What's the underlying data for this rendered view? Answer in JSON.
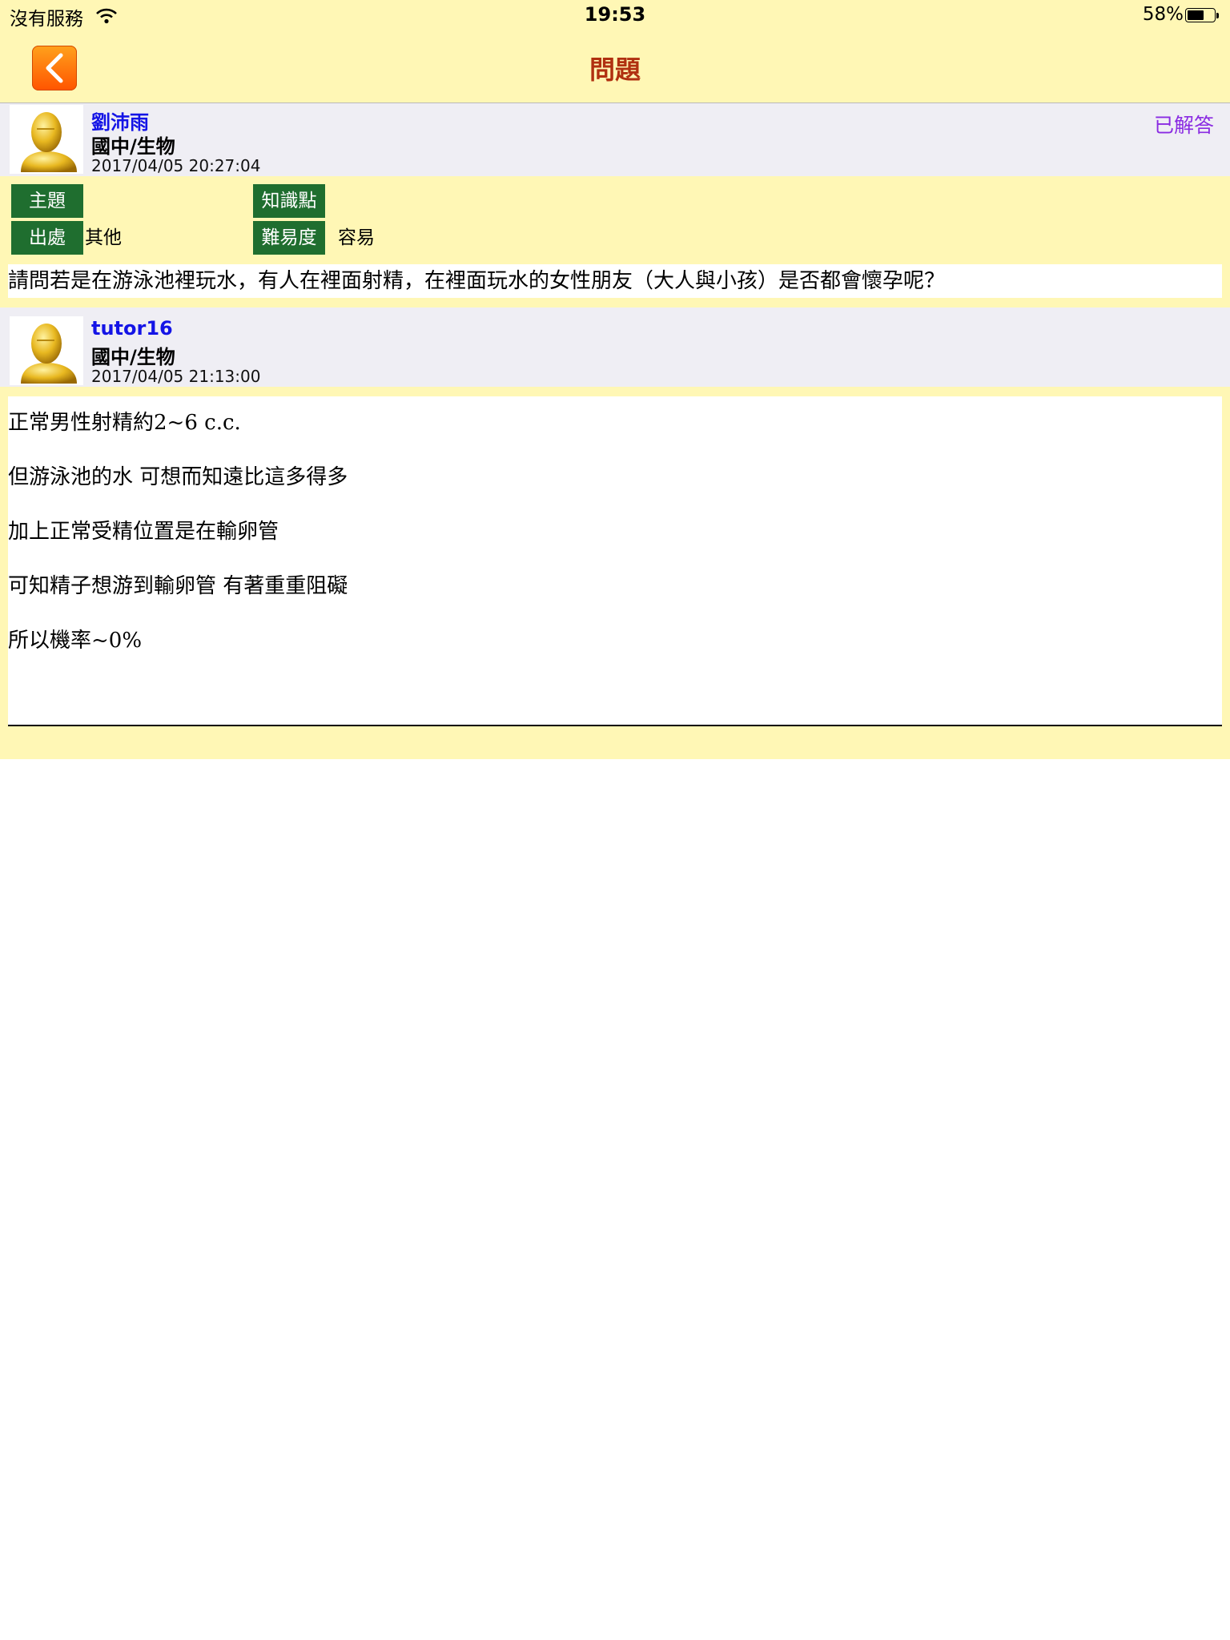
{
  "status_bar": {
    "carrier": "沒有服務",
    "time": "19:53",
    "battery": "58%",
    "battery_level": 0.58
  },
  "nav": {
    "title": "問題"
  },
  "question": {
    "author": "劉沛雨",
    "subject": "國中/生物",
    "datetime": "2017/04/05 20:27:04",
    "status": "已解答",
    "tags": [
      {
        "label": "主題",
        "value": ""
      },
      {
        "label": "知識點",
        "value": ""
      },
      {
        "label": "出處",
        "value": "其他"
      },
      {
        "label": "難易度",
        "value": "容易"
      }
    ],
    "text": "請問若是在游泳池裡玩水，有人在裡面射精，在裡面玩水的女性朋友（大人與小孩）是否都會懷孕呢？"
  },
  "answer": {
    "author": "tutor16",
    "subject": "國中/生物",
    "datetime": "2017/04/05 21:13:00",
    "lines": [
      "正常男性射精約2~6 c.c.",
      "但游泳池的水 可想而知遠比這多得多",
      "加上正常受精位置是在輸卵管",
      "可知精子想游到輸卵管 有著重重阻礙",
      "所以機率~0%"
    ]
  }
}
